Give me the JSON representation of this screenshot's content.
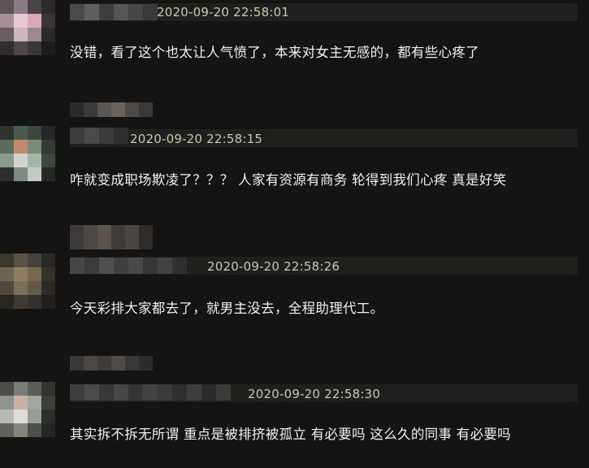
{
  "comments": [
    {
      "timestamp": "2020-09-20 22:58:01",
      "text": "没错，看了这个也太让人气愤了，本来对女主无感的，都有些心疼了"
    },
    {
      "timestamp": "2020-09-20 22:58:15",
      "text": "咋就变成职场欺凌了？？？ 人家有资源有商务 轮得到我们心疼 真是好笑"
    },
    {
      "timestamp": "2020-09-20 22:58:26",
      "text": "今天彩排大家都去了，就男主没去，全程助理代工。"
    },
    {
      "timestamp": "2020-09-20 22:58:30",
      "text": "其实拆不拆无所谓 重点是被排挤被孤立 有必要吗 这么久的同事 有必要吗"
    }
  ],
  "colors": {
    "background": "#141414",
    "text": "#f0f0f0",
    "timestamp": "#c9c7b4"
  }
}
